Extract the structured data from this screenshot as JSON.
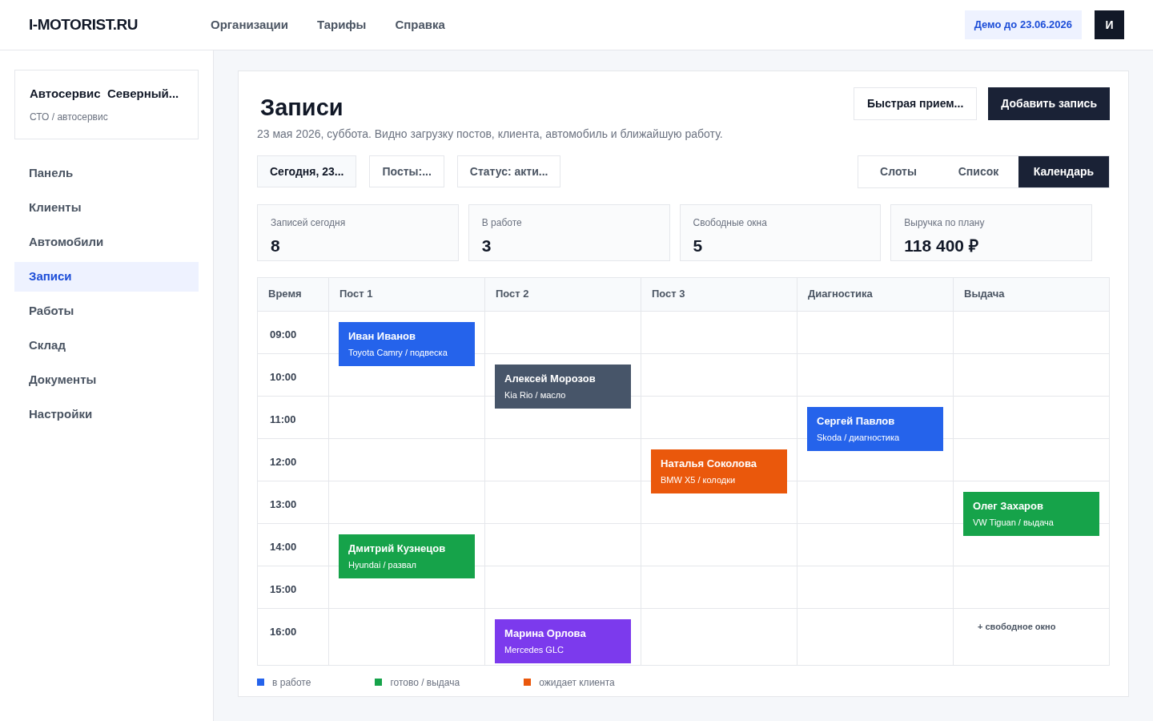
{
  "header": {
    "logo": "I-MOTORIST.RU",
    "nav": [
      "Организации",
      "Тарифы",
      "Справка"
    ],
    "demo_badge": "Демо до 23.06.2026",
    "avatar": "И"
  },
  "sidebar": {
    "org": {
      "name": "Автосервис  Северный...",
      "type": "СТО / автосервис"
    },
    "items": [
      {
        "label": "Панель",
        "selected": false
      },
      {
        "label": "Клиенты",
        "selected": false
      },
      {
        "label": "Автомобили",
        "selected": false
      },
      {
        "label": "Записи",
        "selected": true
      },
      {
        "label": "Работы",
        "selected": false
      },
      {
        "label": "Склад",
        "selected": false
      },
      {
        "label": "Документы",
        "selected": false
      },
      {
        "label": "Настройки",
        "selected": false
      }
    ]
  },
  "page": {
    "title": "Записи",
    "subtitle": "23 мая 2026, суббота. Видно загрузку постов, клиента, автомобиль и ближайшую работу.",
    "actions": [
      {
        "label": "Быстрая прием...",
        "kind": "secondary"
      },
      {
        "label": "Добавить запись",
        "kind": "primary"
      }
    ],
    "filters": [
      {
        "label": "Сегодня, 23...",
        "selected": true
      },
      {
        "label": "Посты:...",
        "selected": false
      },
      {
        "label": "Статус: акти...",
        "selected": false
      }
    ],
    "views": [
      {
        "label": "Слоты",
        "selected": false
      },
      {
        "label": "Список",
        "selected": false
      },
      {
        "label": "Календарь",
        "selected": true
      }
    ],
    "stats": [
      {
        "label": "Записей сегодня",
        "value": "8"
      },
      {
        "label": "В работе",
        "value": "3"
      },
      {
        "label": "Свободные окна",
        "value": "5"
      },
      {
        "label": "Выручка по плану",
        "value": "118 400 ₽"
      }
    ]
  },
  "schedule": {
    "columns": [
      "Время",
      "Пост 1",
      "Пост 2",
      "Пост 3",
      "Диагностика",
      "Выдача"
    ],
    "rows": [
      {
        "cells": [
          {
            "kind": "time",
            "label": "09:00"
          },
          {
            "kind": "appointment",
            "name": "Иван Иванов",
            "detail": "Toyota Camry / подвеска",
            "color": "#2563eb"
          },
          {
            "kind": "empty"
          },
          {
            "kind": "empty"
          },
          {
            "kind": "empty"
          },
          {
            "kind": "empty"
          }
        ]
      },
      {
        "cells": [
          {
            "kind": "time",
            "label": "10:00"
          },
          {
            "kind": "empty"
          },
          {
            "kind": "appointment",
            "name": "Алексей Морозов",
            "detail": "Kia Rio / масло",
            "color": "#475569"
          },
          {
            "kind": "empty"
          },
          {
            "kind": "empty"
          },
          {
            "kind": "empty"
          }
        ]
      },
      {
        "cells": [
          {
            "kind": "time",
            "label": "11:00"
          },
          {
            "kind": "empty"
          },
          {
            "kind": "empty"
          },
          {
            "kind": "empty"
          },
          {
            "kind": "appointment",
            "name": "Сергей Павлов",
            "detail": "Skoda / диагностика",
            "color": "#2563eb"
          },
          {
            "kind": "empty"
          }
        ]
      },
      {
        "cells": [
          {
            "kind": "time",
            "label": "12:00"
          },
          {
            "kind": "empty"
          },
          {
            "kind": "empty"
          },
          {
            "kind": "appointment",
            "name": "Наталья Соколова",
            "detail": "BMW X5 / колодки",
            "color": "#ea580c"
          },
          {
            "kind": "empty"
          },
          {
            "kind": "empty"
          }
        ]
      },
      {
        "cells": [
          {
            "kind": "time",
            "label": "13:00"
          },
          {
            "kind": "empty"
          },
          {
            "kind": "empty"
          },
          {
            "kind": "empty"
          },
          {
            "kind": "empty"
          },
          {
            "kind": "appointment",
            "name": "Олег Захаров",
            "detail": "VW Tiguan / выдача",
            "color": "#16a34a"
          }
        ]
      },
      {
        "cells": [
          {
            "kind": "time",
            "label": "14:00"
          },
          {
            "kind": "appointment",
            "name": "Дмитрий Кузнецов",
            "detail": "Hyundai / развал",
            "color": "#16a34a"
          },
          {
            "kind": "empty"
          },
          {
            "kind": "empty"
          },
          {
            "kind": "empty"
          },
          {
            "kind": "empty"
          }
        ]
      },
      {
        "cells": [
          {
            "kind": "time",
            "label": "15:00"
          },
          {
            "kind": "empty"
          },
          {
            "kind": "empty"
          },
          {
            "kind": "empty"
          },
          {
            "kind": "empty"
          },
          {
            "kind": "empty"
          }
        ]
      },
      {
        "cells": [
          {
            "kind": "time",
            "label": "16:00"
          },
          {
            "kind": "empty"
          },
          {
            "kind": "appointment",
            "name": "Марина Орлова",
            "detail": "Mercedes GLC",
            "color": "#7c3aed"
          },
          {
            "kind": "empty"
          },
          {
            "kind": "empty"
          },
          {
            "kind": "free_slot",
            "label": "+ свободное окно"
          }
        ]
      }
    ]
  },
  "legend": [
    {
      "label": "в работе",
      "color": "#2563eb"
    },
    {
      "label": "готово / выдача",
      "color": "#16a34a"
    },
    {
      "label": "ожидает клиента",
      "color": "#ea580c"
    }
  ]
}
